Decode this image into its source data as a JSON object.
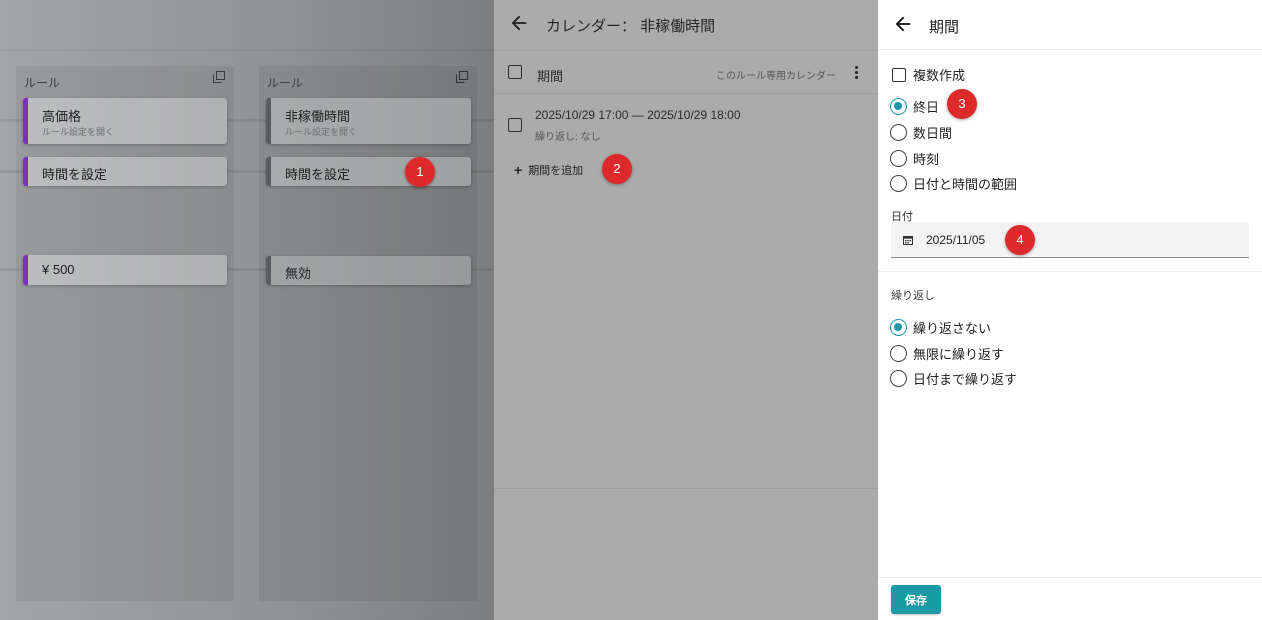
{
  "colors": {
    "accent": "#1b9aa6",
    "marker": "#dc2a2a",
    "rule_purple": "#7b2fbf",
    "rule_gray": "#5a5c5e"
  },
  "board": {
    "columns": [
      {
        "title": "ルール",
        "copy_icon": "copy-icon",
        "cards": [
          {
            "title": "高価格",
            "subtitle": "ルール設定を開く",
            "color": "purple"
          },
          {
            "title": "時間を設定",
            "color": "purple"
          },
          {
            "title": "¥ 500",
            "color": "purple"
          }
        ]
      },
      {
        "title": "ルール",
        "copy_icon": "copy-icon",
        "cards": [
          {
            "title": "非稼働時間",
            "subtitle": "ルール設定を開く",
            "color": "gray"
          },
          {
            "title": "時間を設定",
            "color": "gray"
          },
          {
            "title": "無効",
            "color": "gray"
          }
        ]
      }
    ]
  },
  "calendar": {
    "back_icon": "arrow-left-icon",
    "title": "カレンダー： 非稼働時間",
    "list_header": {
      "label": "期間",
      "right_text": "このルール専用カレンダー",
      "menu_icon": "more-vert-icon"
    },
    "period": {
      "datetime": "2025/10/29 17:00 — 2025/10/29 18:00",
      "repeat": "繰り返し: なし"
    },
    "add_label": "期間を追加"
  },
  "editor": {
    "back_icon": "arrow-left-icon",
    "title": "期間",
    "multi_label": "複数作成",
    "duration_options": [
      {
        "label": "終日",
        "selected": true
      },
      {
        "label": "数日間",
        "selected": false
      },
      {
        "label": "時刻",
        "selected": false
      },
      {
        "label": "日付と時間の範囲",
        "selected": false
      }
    ],
    "date_label": "日付",
    "date_value": "2025/11/05",
    "repeat_label": "繰り返し",
    "repeat_options": [
      {
        "label": "繰り返さない",
        "selected": true
      },
      {
        "label": "無限に繰り返す",
        "selected": false
      },
      {
        "label": "日付まで繰り返す",
        "selected": false
      }
    ],
    "save_label": "保存"
  },
  "markers": [
    "1",
    "2",
    "3",
    "4"
  ]
}
